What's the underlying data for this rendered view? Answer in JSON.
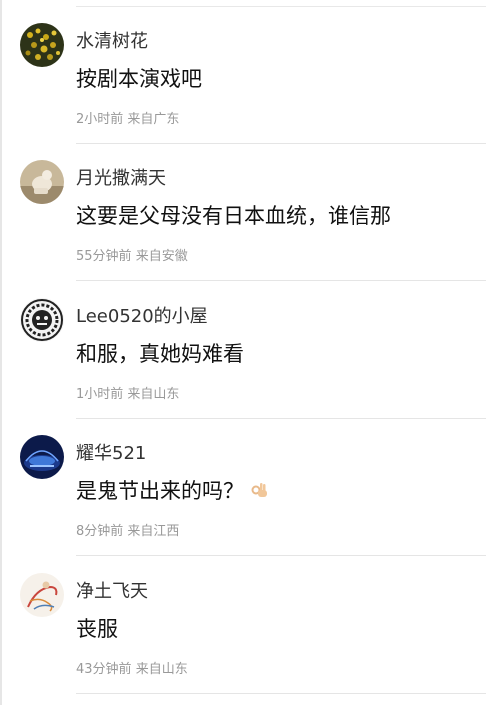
{
  "comments": [
    {
      "user": "水清树花",
      "text": "按剧本演戏吧",
      "time": "2小时前",
      "location": "来自广东",
      "avatar_icon": "yellow-flowers-avatar",
      "emoji": ""
    },
    {
      "user": "月光撒满天",
      "text": "这要是父母没有日本血统，谁信那",
      "time": "55分钟前",
      "location": "来自安徽",
      "avatar_icon": "sculpture-avatar",
      "emoji": ""
    },
    {
      "user": "Lee0520的小屋",
      "text": "和服，真她妈难看",
      "time": "1小时前",
      "location": "来自山东",
      "avatar_icon": "lion-emblem-avatar",
      "emoji": ""
    },
    {
      "user": "耀华521",
      "text": "是鬼节出来的吗？",
      "time": "8分钟前",
      "location": "来自江西",
      "avatar_icon": "stadium-night-avatar",
      "emoji": "ok-hand-emoji"
    },
    {
      "user": "净土飞天",
      "text": "丧服",
      "time": "43分钟前",
      "location": "来自山东",
      "avatar_icon": "flying-apsara-avatar",
      "emoji": ""
    }
  ]
}
